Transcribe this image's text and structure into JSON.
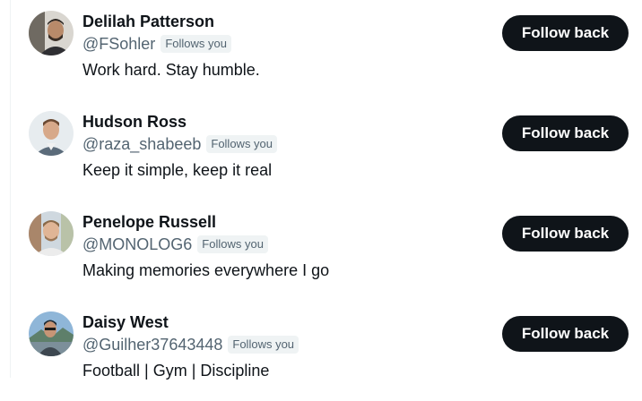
{
  "follow_list": {
    "users": [
      {
        "name": "Delilah Patterson",
        "handle": "@FSohler",
        "badge": "Follows you",
        "bio": "Work hard. Stay humble.",
        "button_label": "Follow back"
      },
      {
        "name": "Hudson Ross",
        "handle": "@raza_shabeeb",
        "badge": "Follows you",
        "bio": "Keep it simple, keep it real",
        "button_label": "Follow back"
      },
      {
        "name": "Penelope Russell",
        "handle": "@MONOLOG6",
        "badge": "Follows you",
        "bio": "Making memories everywhere I go",
        "button_label": "Follow back"
      },
      {
        "name": "Daisy West",
        "handle": "@Guilher37643448",
        "badge": "Follows you",
        "bio": "Football | Gym | Discipline",
        "button_label": "Follow back"
      }
    ]
  },
  "colors": {
    "text_primary": "#0f1419",
    "text_secondary": "#536471",
    "badge_bg": "#eff3f4",
    "button_bg": "#0f1419",
    "button_text": "#ffffff"
  }
}
